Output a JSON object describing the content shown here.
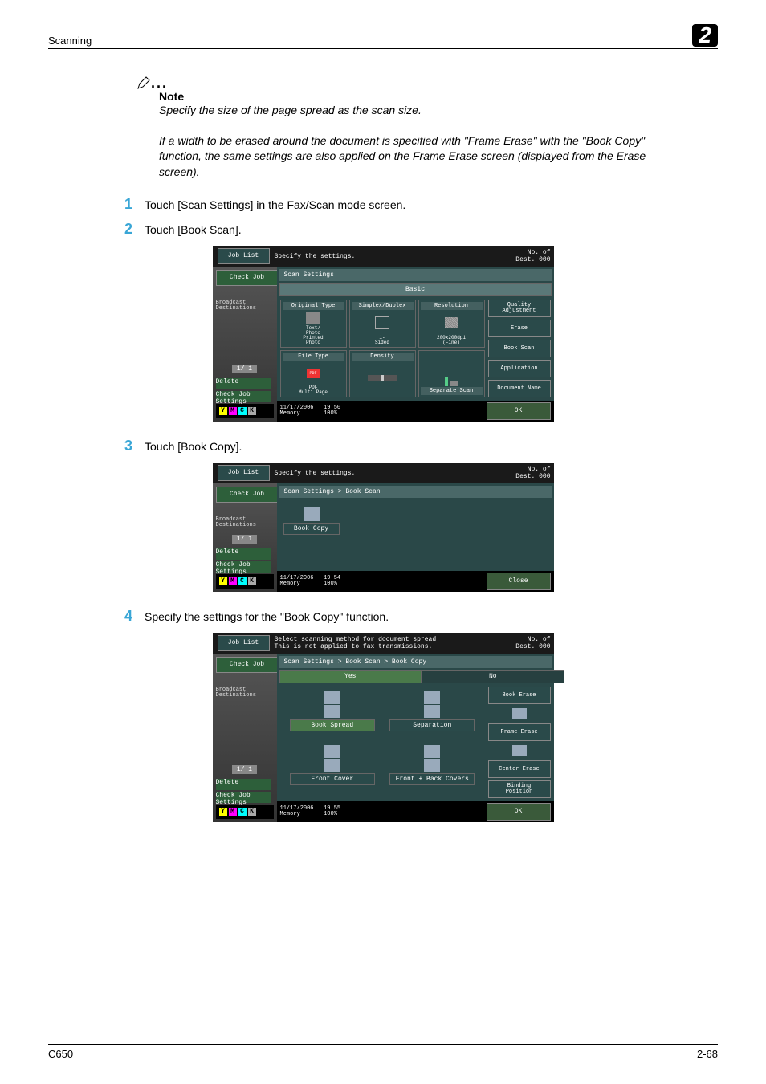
{
  "header": {
    "left": "Scanning",
    "right": "2"
  },
  "note": {
    "title": "Note",
    "p1": "Specify the size of the page spread as the scan size.",
    "p2": "If a width to be erased around the document is specified with \"Frame Erase\" with the \"Book Copy\" function, the same settings are also applied on the Frame Erase screen (displayed from the Erase screen)."
  },
  "steps": {
    "s1": {
      "num": "1",
      "text": "Touch [Scan Settings] in the Fax/Scan mode screen."
    },
    "s2": {
      "num": "2",
      "text": "Touch [Book Scan]."
    },
    "s3": {
      "num": "3",
      "text": "Touch [Book Copy]."
    },
    "s4": {
      "num": "4",
      "text": "Specify the settings for the \"Book Copy\" function."
    }
  },
  "footer": {
    "left": "C650",
    "right": "2-68"
  },
  "shared_left": {
    "job_list": "Job List",
    "check_job": "Check Job",
    "bcast": "Broadcast\nDestinations",
    "pager": "1/  1",
    "delete": "Delete",
    "chk_settings": "Check Job\nSettings",
    "toner": [
      "Y",
      "M",
      "C",
      "K"
    ]
  },
  "shared_dest": {
    "label": "No. of\nDest.",
    "val": "000"
  },
  "screen1": {
    "msg": "Specify the settings.",
    "breadcrumb": "Scan Settings",
    "tab": "Basic",
    "cells": {
      "c1": {
        "head": "Original Type",
        "sub": "Text/\nPhoto\nPrinted\nPhoto"
      },
      "c2": {
        "head": "Simplex/Duplex",
        "sub": "1-\nSided"
      },
      "c3": {
        "head": "Resolution",
        "sub": "200x200dpi\n(Fine)"
      },
      "c4": {
        "head": "File Type",
        "sub": "PDF\nMulti Page"
      },
      "c5": {
        "head": "Density",
        "sub": ""
      },
      "c6": {
        "head": "",
        "sub": "Separate Scan"
      }
    },
    "right": [
      "Quality\nAdjustment",
      "Erase",
      "Book Scan",
      "Application",
      "Document Name"
    ],
    "footer_l": "11/17/2006   19:50\nMemory       100%",
    "footer_btn": "OK"
  },
  "screen2": {
    "msg": "Specify the settings.",
    "breadcrumb": "Scan Settings > Book Scan",
    "btn": "Book Copy",
    "footer_l": "11/17/2006   19:54\nMemory       100%",
    "footer_btn": "Close"
  },
  "screen3": {
    "msg_l1": "Select scanning method for document spread.",
    "msg_l2": "This is not applied to fax transmissions.",
    "breadcrumb": "Scan Settings > Book Scan > Book Copy",
    "yes": "Yes",
    "no": "No",
    "items": [
      "Book Spread",
      "Separation",
      "Front Cover",
      "Front + Back Covers"
    ],
    "right": [
      "Book Erase",
      "Frame Erase",
      "Center Erase",
      "Binding\nPosition"
    ],
    "footer_l": "11/17/2006   19:55\nMemory       100%",
    "footer_btn": "OK"
  }
}
